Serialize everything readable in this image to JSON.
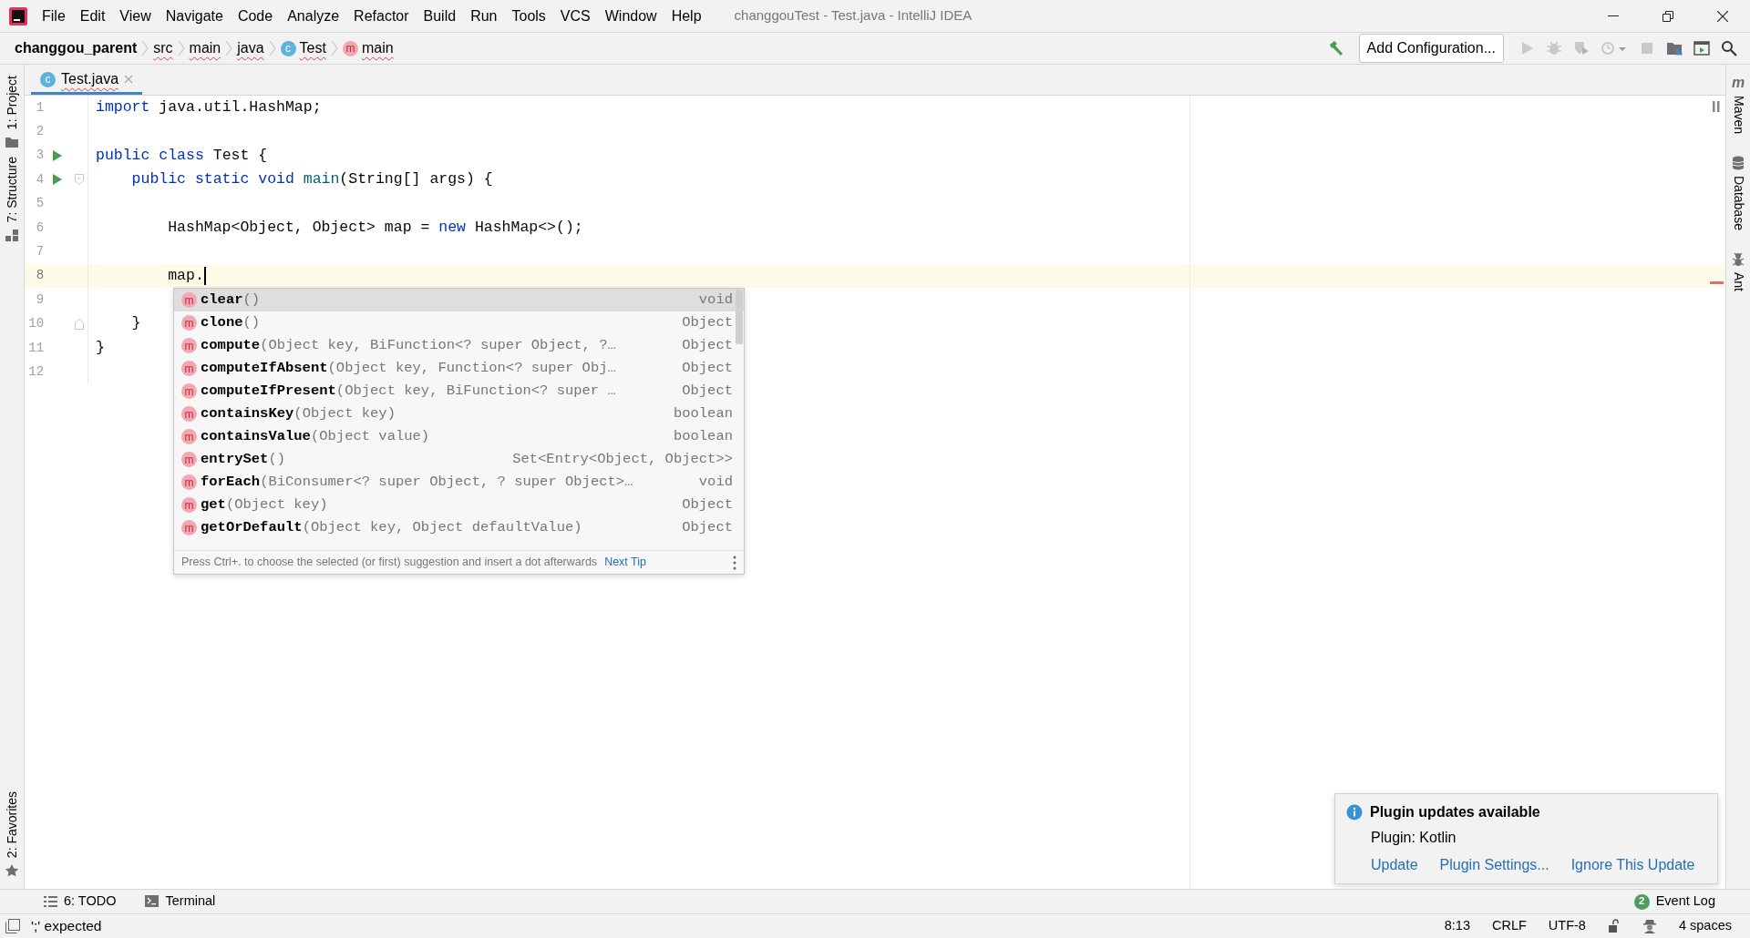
{
  "window": {
    "title": "changgouTest - Test.java - IntelliJ IDEA"
  },
  "menu": [
    "File",
    "Edit",
    "View",
    "Navigate",
    "Code",
    "Analyze",
    "Refactor",
    "Build",
    "Run",
    "Tools",
    "VCS",
    "Window",
    "Help"
  ],
  "breadcrumbs": [
    {
      "label": "changgou_parent",
      "kind": "project",
      "error": false
    },
    {
      "label": "src",
      "kind": "folder",
      "error": true
    },
    {
      "label": "main",
      "kind": "folder",
      "error": true
    },
    {
      "label": "java",
      "kind": "folder",
      "error": true
    },
    {
      "label": "Test",
      "kind": "class",
      "icon": "c",
      "error": true
    },
    {
      "label": "main",
      "kind": "method",
      "icon": "m",
      "error": true
    }
  ],
  "toolbar": {
    "run_configuration": "Add Configuration..."
  },
  "left_tool_windows": [
    {
      "label": "1: Project",
      "kind": "project"
    },
    {
      "label": "7: Structure",
      "kind": "structure"
    },
    {
      "label": "2: Favorites",
      "kind": "favorites"
    }
  ],
  "right_tool_windows": [
    {
      "label": "Maven",
      "kind": "maven",
      "icon": "m"
    },
    {
      "label": "Database",
      "kind": "database"
    },
    {
      "label": "Ant",
      "kind": "ant"
    }
  ],
  "editor_tabs": [
    {
      "label": "Test.java",
      "icon": "c",
      "selected": true,
      "error": true
    }
  ],
  "code_lines": [
    {
      "number": "1",
      "current": false,
      "run": false,
      "tokens": [
        {
          "text": "import",
          "kind": "keyword"
        },
        {
          "text": " java.util.HashMap;",
          "kind": "plain"
        }
      ]
    },
    {
      "number": "2",
      "current": false,
      "run": false
    },
    {
      "number": "3",
      "current": false,
      "run": true,
      "tokens": [
        {
          "text": "public class",
          "kind": "keyword"
        },
        {
          "text": " Test {",
          "kind": "plain"
        }
      ]
    },
    {
      "number": "4",
      "current": false,
      "run": true,
      "fold_start": true,
      "tokens": [
        {
          "text": "    public static void",
          "kind": "keyword"
        },
        {
          "text": " main",
          "kind": "method"
        },
        {
          "text": "(String[] args) {",
          "kind": "plain"
        }
      ]
    },
    {
      "number": "5",
      "current": false,
      "run": false
    },
    {
      "number": "6",
      "current": false,
      "run": false,
      "tokens": [
        {
          "text": "        HashMap<Object, Object> map = ",
          "kind": "plain"
        },
        {
          "text": "new",
          "kind": "keyword"
        },
        {
          "text": " HashMap<>();",
          "kind": "plain"
        }
      ]
    },
    {
      "number": "7",
      "current": false,
      "run": false
    },
    {
      "number": "8",
      "current": true,
      "run": false,
      "tokens": [
        {
          "text": "        map.",
          "kind": "plain"
        }
      ]
    },
    {
      "number": "9",
      "current": false,
      "run": false
    },
    {
      "number": "10",
      "current": false,
      "run": false,
      "fold_end": true,
      "tokens": [
        {
          "text": "    }",
          "kind": "plain"
        }
      ]
    },
    {
      "number": "11",
      "current": false,
      "run": false,
      "tokens": [
        {
          "text": "}",
          "kind": "plain"
        }
      ]
    },
    {
      "number": "12",
      "current": false,
      "run": false
    }
  ],
  "completion": {
    "items": [
      {
        "icon": "m",
        "name": "clear",
        "params": "()",
        "type": "void",
        "selected": true
      },
      {
        "icon": "m",
        "name": "clone",
        "params": "()",
        "type": "Object",
        "selected": false
      },
      {
        "icon": "m",
        "name": "compute",
        "params": "(Object key, BiFunction<? super Object, ?…",
        "type": "Object",
        "selected": false
      },
      {
        "icon": "m",
        "name": "computeIfAbsent",
        "params": "(Object key, Function<? super Obj…",
        "type": "Object",
        "selected": false
      },
      {
        "icon": "m",
        "name": "computeIfPresent",
        "params": "(Object key, BiFunction<? super …",
        "type": "Object",
        "selected": false
      },
      {
        "icon": "m",
        "name": "containsKey",
        "params": "(Object key)",
        "type": "boolean",
        "selected": false
      },
      {
        "icon": "m",
        "name": "containsValue",
        "params": "(Object value)",
        "type": "boolean",
        "selected": false
      },
      {
        "icon": "m",
        "name": "entrySet",
        "params": "()",
        "type": "Set<Entry<Object, Object>>",
        "selected": false
      },
      {
        "icon": "m",
        "name": "forEach",
        "params": "(BiConsumer<? super Object, ? super Object>…",
        "type": "void",
        "selected": false
      },
      {
        "icon": "m",
        "name": "get",
        "params": "(Object key)",
        "type": "Object",
        "selected": false
      },
      {
        "icon": "m",
        "name": "getOrDefault",
        "params": "(Object key, Object defaultValue)",
        "type": "Object",
        "selected": false
      }
    ],
    "hint": "Press Ctrl+. to choose the selected (or first) suggestion and insert a dot afterwards",
    "next_tip": "Next Tip"
  },
  "notification": {
    "title": "Plugin updates available",
    "body": "Plugin: Kotlin",
    "actions": [
      "Update",
      "Plugin Settings...",
      "Ignore This Update"
    ]
  },
  "bottom_tools": [
    {
      "label": "6: TODO",
      "kind": "todo"
    },
    {
      "label": "Terminal",
      "kind": "terminal"
    }
  ],
  "event_log": {
    "count": "2",
    "label": "Event Log"
  },
  "status_bar": {
    "message": "';' expected",
    "position": "8:13",
    "line_separator": "CRLF",
    "encoding": "UTF-8",
    "indent": "4 spaces"
  }
}
